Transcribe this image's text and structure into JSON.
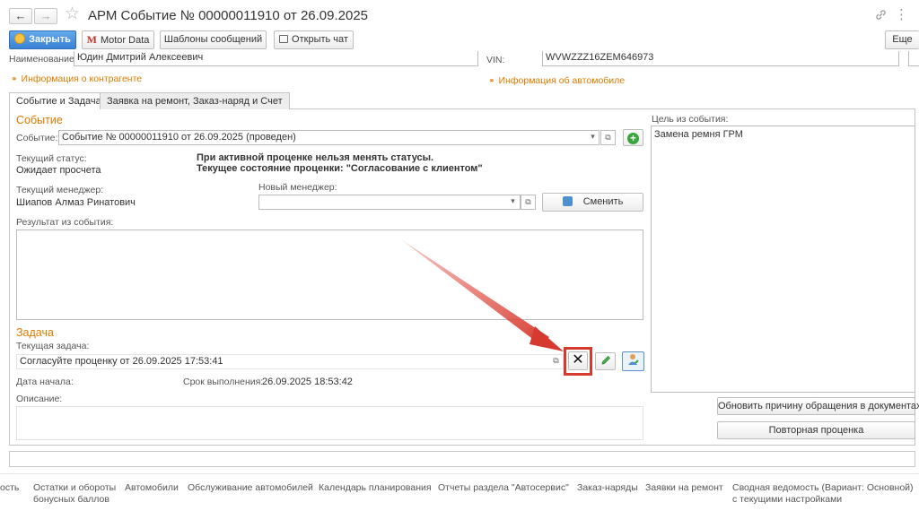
{
  "window": {
    "title": "АРМ Событие № 00000011910 от 26.09.2025",
    "back_icon": "←",
    "forward_icon": "→",
    "star_icon": "☆"
  },
  "toolbar": {
    "close_label": "Закрыть",
    "motor_label": "Motor Data",
    "templates_label": "Шаблоны сообщений",
    "chat_label": "Открыть чат",
    "more_label": "Еще"
  },
  "header_fields": {
    "name_label": "Наименование:",
    "name_value": "Юдин Дмитрий Алексеевич",
    "vin_label": "VIN:",
    "vin_value": "WVWZZZ16ZEM646973",
    "contractor_link": "Информация о контрагенте",
    "car_link": "Информация об автомобиле"
  },
  "tabs": [
    {
      "label": "Событие и Задача"
    },
    {
      "label": "Заявка на ремонт, Заказ-наряд и Счет"
    }
  ],
  "event": {
    "section_title": "Событие",
    "event_label": "Событие:",
    "event_value": "Событие № 00000011910 от 26.09.2025 (проведен)",
    "status_label": "Текущий статус:",
    "status_value": "Ожидает просчета",
    "warning_line1": "При активной проценке нельзя менять статусы.",
    "warning_line2": "Текущее состояние проценки: \"Согласование с клиентом\"",
    "manager_label": "Текущий менеджер:",
    "manager_value": "Шиапов Алмаз Ринатович",
    "new_manager_label": "Новый менеджер:",
    "new_manager_value": "",
    "change_label": "Сменить",
    "result_label": "Результат из события:",
    "result_value": ""
  },
  "task": {
    "section_title": "Задача",
    "current_label": "Текущая задача:",
    "current_value": "Согласуйте проценку от 26.09.2025 17:53:41",
    "start_label": "Дата начала:",
    "start_value": "",
    "due_label": "Срок выполнения:",
    "due_value": "26.09.2025 18:53:42",
    "description_label": "Описание:",
    "description_value": ""
  },
  "goal": {
    "label": "Цель из события:",
    "value": "Замена ремня ГРМ"
  },
  "side_buttons": {
    "update_reason": "Обновить причину обращения в документах",
    "recalc": "Повторная проценка"
  },
  "bottom_links": [
    "ость",
    "Остатки и обороты бонусных баллов",
    "Автомобили",
    "Обслуживание автомобилей",
    "Календарь планирования",
    "Отчеты раздела \"Автосервис\"",
    "Заказ-наряды",
    "Заявки на ремонт",
    "Сводная ведомость (Вариант: Основной) с текущими настройками"
  ],
  "colors": {
    "accent_orange": "#e07b00",
    "primary_blue": "#3a82d4",
    "annotation_red": "#d63a2f",
    "add_green": "#3aa53a"
  }
}
